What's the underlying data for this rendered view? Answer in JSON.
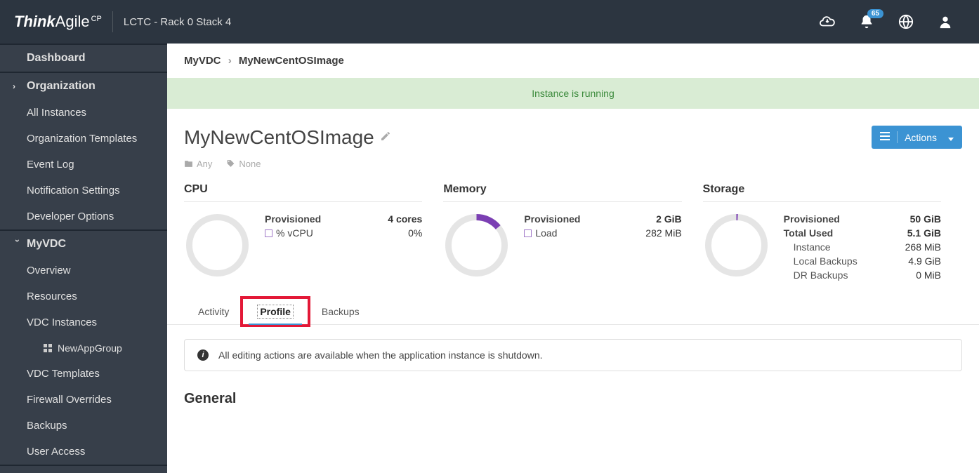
{
  "header": {
    "brand_bold": "Think",
    "brand_light": "Agile",
    "brand_sup": "CP",
    "location": "LCTC - Rack 0 Stack 4",
    "notif_count": "65"
  },
  "sidebar": {
    "dashboard": "Dashboard",
    "organization": "Organization",
    "org_items": {
      "all_instances": "All Instances",
      "org_templates": "Organization Templates",
      "event_log": "Event Log",
      "notif_settings": "Notification Settings",
      "dev_options": "Developer Options"
    },
    "vdc_label": "MyVDC",
    "vdc_items": {
      "overview": "Overview",
      "resources": "Resources",
      "vdc_instances": "VDC Instances",
      "new_app_group": "NewAppGroup",
      "vdc_templates": "VDC Templates",
      "firewall": "Firewall Overrides",
      "backups": "Backups",
      "user_access": "User Access"
    }
  },
  "main": {
    "crumb_root": "MyVDC",
    "crumb_sep": "›",
    "crumb_leaf": "MyNewCentOSImage",
    "banner": "Instance is running",
    "title": "MyNewCentOSImage",
    "tag_folder": "Any",
    "tag_label": "None",
    "actions_label": "Actions"
  },
  "metrics": {
    "cpu": {
      "title": "CPU",
      "prov_label": "Provisioned",
      "prov_value": "4 cores",
      "vcpu_label": "% vCPU",
      "vcpu_value": "0%",
      "donut_frac": 0
    },
    "memory": {
      "title": "Memory",
      "prov_label": "Provisioned",
      "prov_value": "2 GiB",
      "load_label": "Load",
      "load_value": "282 MiB",
      "donut_frac": 0.14
    },
    "storage": {
      "title": "Storage",
      "prov_label": "Provisioned",
      "prov_value": "50 GiB",
      "total_label": "Total Used",
      "total_value": "5.1 GiB",
      "instance_label": "Instance",
      "instance_value": "268 MiB",
      "local_label": "Local Backups",
      "local_value": "4.9 GiB",
      "dr_label": "DR Backups",
      "dr_value": "0 MiB",
      "donut_frac": 0.005
    }
  },
  "tabs": {
    "activity": "Activity",
    "profile": "Profile",
    "backups": "Backups"
  },
  "notice": "All editing actions are available when the application instance is shutdown.",
  "general_hdr": "General"
}
